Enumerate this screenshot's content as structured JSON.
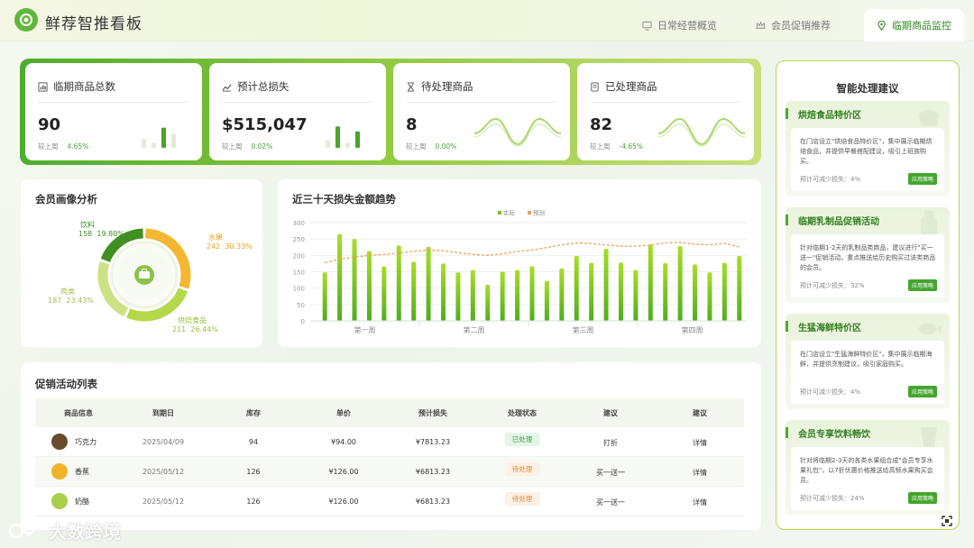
{
  "header": {
    "title": "鲜荐智推看板",
    "tabs": [
      {
        "label": "日常经营概览",
        "icon": "monitor-icon"
      },
      {
        "label": "会员促销推荐",
        "icon": "crown-icon"
      },
      {
        "label": "临期商品监控",
        "icon": "location-pin-icon",
        "active": true
      }
    ]
  },
  "kpis": [
    {
      "label": "临期商品总数",
      "value": "90",
      "compare": "较上周",
      "change": "4.65%",
      "icon": "bar-chart-icon",
      "visual": "bars",
      "bars": [
        0.35,
        0.2,
        0.8,
        0.55
      ]
    },
    {
      "label": "预计总损失",
      "value": "$515,047",
      "compare": "较上周",
      "change": "0.02%",
      "icon": "line-chart-icon",
      "visual": "bars",
      "bars": [
        0.3,
        0.85,
        0.2,
        0.65
      ]
    },
    {
      "label": "待处理商品",
      "value": "8",
      "compare": "较上周",
      "change": "0.00%",
      "icon": "hourglass-icon",
      "visual": "wave"
    },
    {
      "label": "已处理商品",
      "value": "82",
      "compare": "较上周",
      "change": "-4.65%",
      "icon": "document-icon",
      "visual": "wave"
    }
  ],
  "member_panel": {
    "title": "会员画像分析",
    "segments": [
      {
        "name": "水果",
        "value": "242",
        "pct": "30.33%",
        "color": "#f5b731"
      },
      {
        "name": "烘焙食品",
        "value": "211",
        "pct": "26.44%",
        "color": "#b3d84a"
      },
      {
        "name": "肉类",
        "value": "187",
        "pct": "23.43%",
        "color": "#cde285"
      },
      {
        "name": "饮料",
        "value": "158",
        "pct": "19.80%",
        "color": "#3f8f22"
      }
    ],
    "center_icon": "briefcase-icon"
  },
  "trend_panel": {
    "title": "近三十天损失金额趋势"
  },
  "chart_data": {
    "type": "bar",
    "title": "近三十天损失金额趋势",
    "legend": [
      "实际",
      "预测"
    ],
    "legend_position": "top-right",
    "ylim": [
      0,
      300
    ],
    "yticks": [
      0,
      50,
      100,
      150,
      200,
      250,
      300
    ],
    "week_labels": [
      "第一周",
      "第二周",
      "第三周",
      "第四周"
    ],
    "series": [
      {
        "name": "实际",
        "type": "bar",
        "values": [
          148,
          265,
          250,
          213,
          166,
          230,
          180,
          226,
          175,
          148,
          155,
          110,
          150,
          155,
          167,
          122,
          160,
          198,
          177,
          220,
          178,
          155,
          233,
          176,
          228,
          172,
          148,
          177,
          198
        ]
      },
      {
        "name": "预测",
        "type": "line",
        "values": [
          178,
          188,
          195,
          200,
          203,
          207,
          212,
          216,
          214,
          208,
          203,
          200,
          205,
          212,
          216,
          224,
          232,
          238,
          236,
          232,
          228,
          228,
          232,
          238,
          240,
          234,
          232,
          237,
          226
        ]
      }
    ],
    "grid": true
  },
  "promo_table": {
    "title": "促销活动列表",
    "columns": [
      "商品信息",
      "到期日",
      "库存",
      "单价",
      "预计损失",
      "处理状态",
      "建议",
      "建议"
    ],
    "rows": [
      {
        "name": "巧克力",
        "date": "2025/04/09",
        "stock": "94",
        "price": "¥94.00",
        "loss": "¥7813.23",
        "status": "已处理",
        "status_type": "done",
        "advice": "打折",
        "action": "详情",
        "thumb_color": "#6b4a2e"
      },
      {
        "name": "香蕉",
        "date": "2025/05/12",
        "stock": "126",
        "price": "¥126.00",
        "loss": "¥6813.23",
        "status": "待处理",
        "status_type": "todo",
        "advice": "买一送一",
        "action": "详情",
        "thumb_color": "#f0b428"
      },
      {
        "name": "奶酪",
        "date": "2025/05/12",
        "stock": "126",
        "price": "¥126.00",
        "loss": "¥6813.23",
        "status": "待处理",
        "status_type": "todo",
        "advice": "买一送一",
        "action": "详情",
        "thumb_color": "#a9cf4e"
      }
    ]
  },
  "suggestions": {
    "title": "智能处理建议",
    "cards": [
      {
        "title": "烘焙食品特价区",
        "desc": "在门店设立\"烘焙食品特价区\"，集中展示临期烘焙食品，并提供早餐搭配建议，吸引上班族购买。",
        "estimate": "预计可减少损失：4%",
        "button": "应用策略",
        "deco": "bread-icon"
      },
      {
        "title": "临期乳制品促销活动",
        "desc": "针对临期1-2天的乳制品类商品，建议进行\"买一送一\"促销活动，重点推送给历史购买过该类商品的会员。",
        "estimate": "预计可减少损失：32%",
        "button": "应用策略",
        "deco": "milk-icon"
      },
      {
        "title": "生猛海鲜特价区",
        "desc": "在门店设立\"生猛海鲜特价区\"，集中展示临期海鲜，并提供烹制建议，吸引家庭购买。",
        "estimate": "预计可减少损失：4%",
        "button": "应用策略",
        "deco": "fish-icon"
      },
      {
        "title": "会员专享饮料畅饮",
        "desc": "针对将临期2-3天的各类水果组合成\"会员专享水果礼包\"，以7折优惠价格推送给高频水果购买会员。",
        "estimate": "预计可减少损失：24%",
        "button": "应用策略",
        "deco": "drink-icon"
      }
    ]
  },
  "watermark": "大数跨境"
}
